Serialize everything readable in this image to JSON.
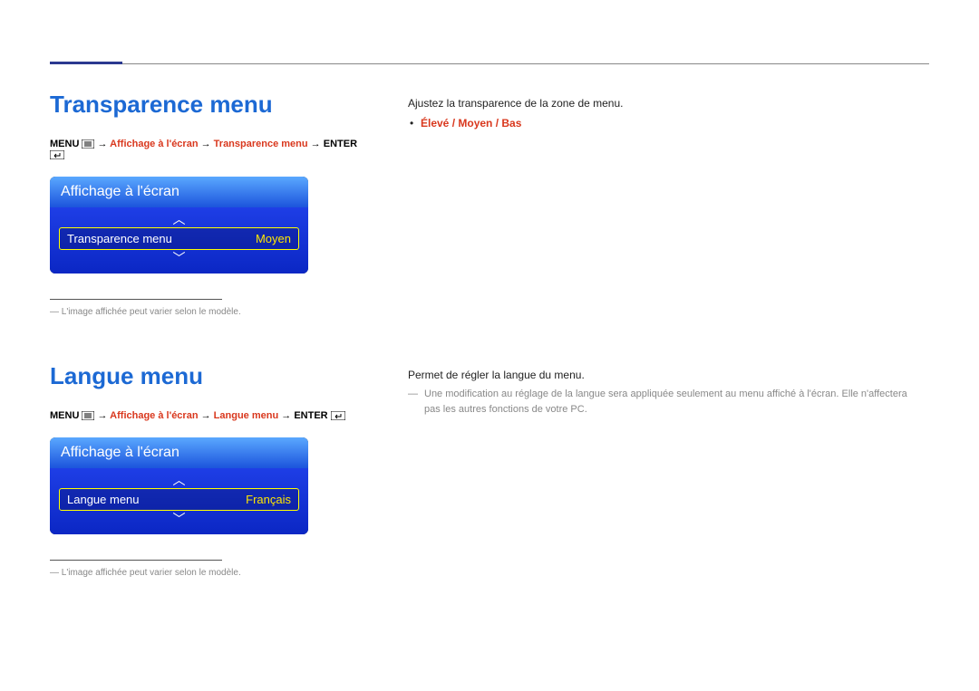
{
  "section1": {
    "title": "Transparence menu",
    "breadcrumb": {
      "menu": "MENU",
      "arrow": "→",
      "step1": "Affichage à l'écran",
      "step2": "Transparence menu",
      "enter": "ENTER"
    },
    "osd": {
      "header": "Affichage à l'écran",
      "label": "Transparence menu",
      "value": "Moyen"
    },
    "footnote": "L'image affichée peut varier selon le modèle.",
    "desc": "Ajustez la transparence de la zone de menu.",
    "options": "Élevé / Moyen / Bas"
  },
  "section2": {
    "title": "Langue menu",
    "breadcrumb": {
      "menu": "MENU",
      "arrow": "→",
      "step1": "Affichage à l'écran",
      "step2": "Langue menu",
      "enter": "ENTER"
    },
    "osd": {
      "header": "Affichage à l'écran",
      "label": "Langue menu",
      "value": "Français"
    },
    "footnote": "L'image affichée peut varier selon le modèle.",
    "desc": "Permet de régler la langue du menu.",
    "note": "Une modification au réglage de la langue sera appliquée seulement au menu affiché à l'écran. Elle n'affectera pas les autres fonctions de votre PC."
  },
  "chart_data": null
}
